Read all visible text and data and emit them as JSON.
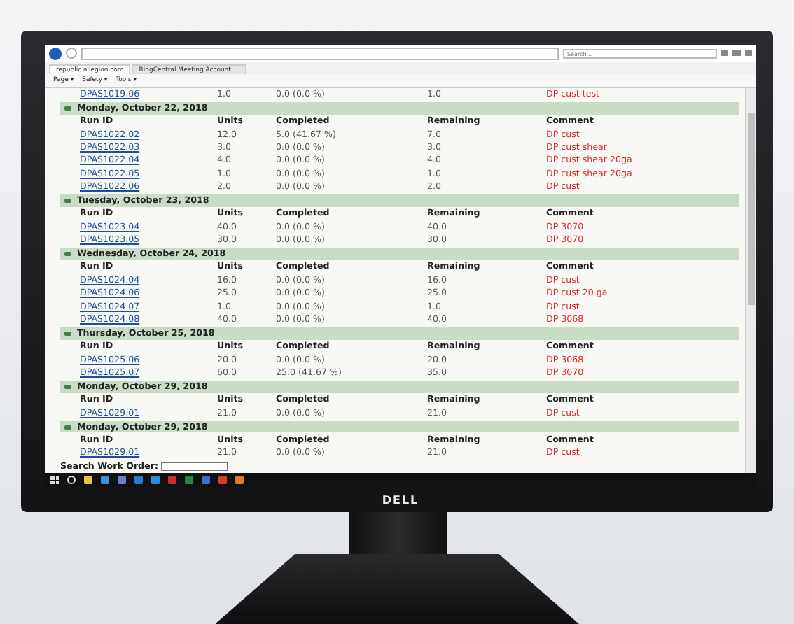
{
  "browser": {
    "search_placeholder": "Search...",
    "tabs": [
      {
        "label": "republic.allegion.com",
        "selected": true
      },
      {
        "label": "RingCentral Meeting Account ...",
        "selected": false
      }
    ],
    "command_bar": [
      "Page ▾",
      "Safety ▾",
      "Tools ▾"
    ]
  },
  "leading_row": [
    "DPAS1019.06",
    "1.0",
    "0.0 (0.0 %)",
    "1.0",
    "DP cust test"
  ],
  "groups": [
    {
      "date": "Monday, October 22, 2018",
      "columns": [
        "Run ID",
        "Units",
        "Completed",
        "Remaining",
        "Comment"
      ],
      "rows": [
        [
          "DPAS1022.02",
          "12.0",
          "5.0 (41.67 %)",
          "7.0",
          "DP cust"
        ],
        [
          "DPAS1022.03",
          "3.0",
          "0.0 (0.0 %)",
          "3.0",
          "DP cust shear"
        ],
        [
          "DPAS1022.04",
          "4.0",
          "0.0 (0.0 %)",
          "4.0",
          "DP cust shear 20ga"
        ],
        [
          "DPAS1022.05",
          "1.0",
          "0.0 (0.0 %)",
          "1.0",
          "DP cust shear 20ga"
        ],
        [
          "DPAS1022.06",
          "2.0",
          "0.0 (0.0 %)",
          "2.0",
          "DP cust"
        ]
      ]
    },
    {
      "date": "Tuesday, October 23, 2018",
      "columns": [
        "Run ID",
        "Units",
        "Completed",
        "Remaining",
        "Comment"
      ],
      "rows": [
        [
          "DPAS1023.04",
          "40.0",
          "0.0 (0.0 %)",
          "40.0",
          "DP 3070"
        ],
        [
          "DPAS1023.05",
          "30.0",
          "0.0 (0.0 %)",
          "30.0",
          "DP 3070"
        ]
      ]
    },
    {
      "date": "Wednesday, October 24, 2018",
      "columns": [
        "Run ID",
        "Units",
        "Completed",
        "Remaining",
        "Comment"
      ],
      "rows": [
        [
          "DPAS1024.04",
          "16.0",
          "0.0 (0.0 %)",
          "16.0",
          "DP cust"
        ],
        [
          "DPAS1024.06",
          "25.0",
          "0.0 (0.0 %)",
          "25.0",
          "DP cust 20 ga"
        ],
        [
          "DPAS1024.07",
          "1.0",
          "0.0 (0.0 %)",
          "1.0",
          "DP cust"
        ],
        [
          "DPAS1024.08",
          "40.0",
          "0.0 (0.0 %)",
          "40.0",
          "DP 3068"
        ]
      ]
    },
    {
      "date": "Thursday, October 25, 2018",
      "columns": [
        "Run ID",
        "Units",
        "Completed",
        "Remaining",
        "Comment"
      ],
      "rows": [
        [
          "DPAS1025.06",
          "20.0",
          "0.0 (0.0 %)",
          "20.0",
          "DP 3068"
        ],
        [
          "DPAS1025.07",
          "60.0",
          "25.0 (41.67 %)",
          "35.0",
          "DP 3070"
        ]
      ]
    },
    {
      "date": "Monday, October 29, 2018",
      "columns": [
        "Run ID",
        "Units",
        "Completed",
        "Remaining",
        "Comment"
      ],
      "rows": [
        [
          "DPAS1029.01",
          "21.0",
          "0.0 (0.0 %)",
          "21.0",
          "DP cust"
        ]
      ]
    },
    {
      "date": "Monday, October 29, 2018",
      "columns": [
        "Run ID",
        "Units",
        "Completed",
        "Remaining",
        "Comment"
      ],
      "rows": [
        [
          "DPAS1029.01",
          "21.0",
          "0.0 (0.0 %)",
          "21.0",
          "DP cust"
        ]
      ]
    }
  ],
  "search": {
    "label": "Search Work Order:"
  },
  "monitor": {
    "brand": "DELL"
  }
}
